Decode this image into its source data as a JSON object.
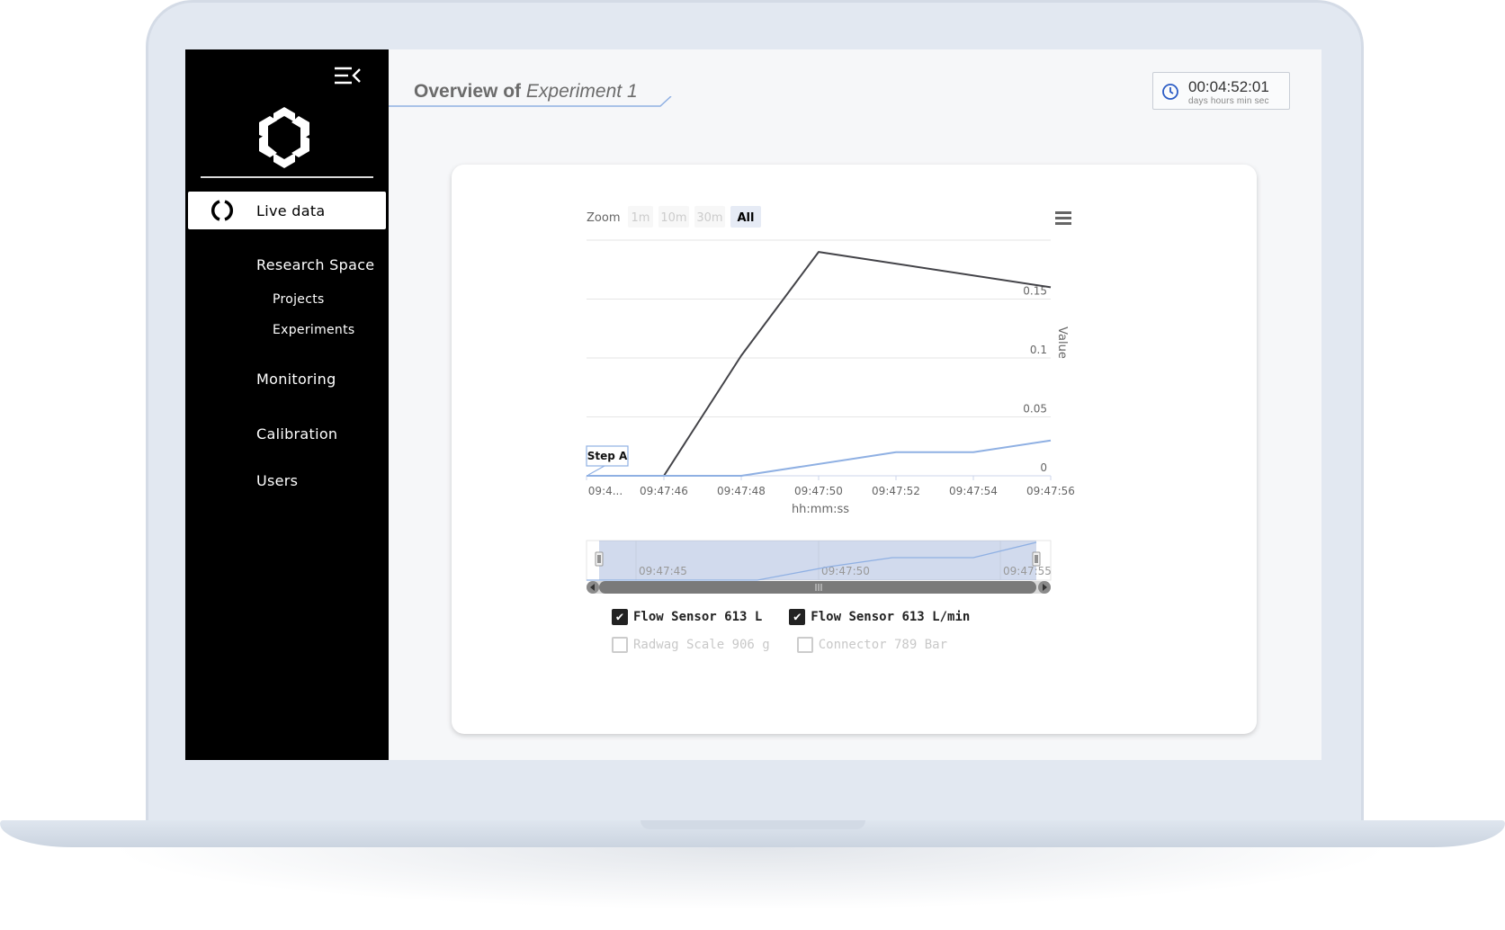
{
  "app": {
    "page_title_prefix": "Overview of",
    "page_title_name": "Experiment 1"
  },
  "sidebar": {
    "items": [
      {
        "label": "Live data",
        "active": true
      },
      {
        "label": "Research Space"
      },
      {
        "label": "Projects",
        "sub": true
      },
      {
        "label": "Experiments",
        "sub": true
      },
      {
        "label": "Monitoring"
      },
      {
        "label": "Calibration"
      },
      {
        "label": "Users"
      }
    ]
  },
  "timer": {
    "value": "00:04:52:01",
    "units": "days hours min sec"
  },
  "zoom": {
    "label": "Zoom",
    "buttons": [
      "1m",
      "10m",
      "30m",
      "All"
    ],
    "selected": "All"
  },
  "colors": {
    "series1": "#434348",
    "series2": "#8fb0e3",
    "accent": "#2b5cc5"
  },
  "chart_data": {
    "type": "line",
    "title": "",
    "xlabel": "hh:mm:ss",
    "ylabel": "Value",
    "x_ticks": [
      "09:4...",
      "09:47:46",
      "09:47:48",
      "09:47:50",
      "09:47:52",
      "09:47:54",
      "09:47:56"
    ],
    "y_ticks": [
      "0",
      "0.05",
      "0.1",
      "0.15"
    ],
    "ylim": [
      0,
      0.2
    ],
    "xlim_seconds": [
      44,
      56
    ],
    "series": [
      {
        "name": "Flow Sensor 613 L",
        "x": [
          44,
          46,
          48,
          50,
          56
        ],
        "y": [
          0,
          0,
          0.102,
          0.19,
          0.16
        ]
      },
      {
        "name": "Flow Sensor 613 L/min",
        "x": [
          44,
          48,
          52,
          54,
          56
        ],
        "y": [
          0,
          0,
          0.02,
          0.02,
          0.03
        ]
      }
    ],
    "annotation": "Step A",
    "navigator_ticks": [
      "09:47:45",
      "09:47:50",
      "09:47:55"
    ],
    "grid": true
  },
  "legend": [
    {
      "label": "Flow Sensor 613 L",
      "checked": true
    },
    {
      "label": "Flow Sensor 613 L/min",
      "checked": true
    },
    {
      "label": "Radwag Scale 906 g",
      "checked": false
    },
    {
      "label": "Connector 789 Bar",
      "checked": false
    }
  ]
}
